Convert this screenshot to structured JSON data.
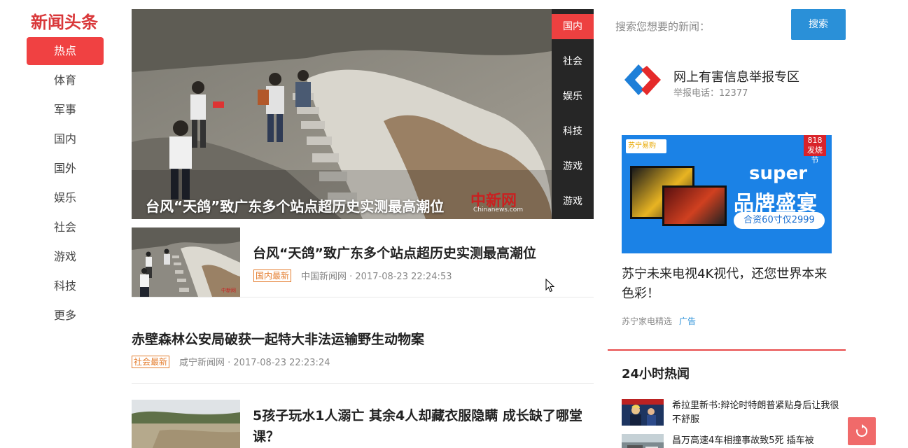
{
  "brand": {
    "logo_text": "新闻头条",
    "accent": "#f04142"
  },
  "nav": {
    "items": [
      {
        "label": "热点",
        "active": true
      },
      {
        "label": "体育"
      },
      {
        "label": "军事"
      },
      {
        "label": "国内"
      },
      {
        "label": "国外"
      },
      {
        "label": "娱乐"
      },
      {
        "label": "社会"
      },
      {
        "label": "游戏"
      },
      {
        "label": "科技"
      },
      {
        "label": "更多"
      }
    ]
  },
  "hero": {
    "title": "台风“天鸽”致广东多个站点超历史实测最高潮位",
    "watermark": "中新网",
    "watermark_sub": "Chinanews.com",
    "tabs": [
      "国内",
      "社会",
      "娱乐",
      "科技",
      "游戏",
      "游戏"
    ]
  },
  "feed": [
    {
      "title": "台风“天鸽”致广东多个站点超历史实测最高潮位",
      "tag": "国内最新",
      "meta": "中国新闻网 · 2017-08-23 22:24:53"
    },
    {
      "title": "赤壁森林公安局破获一起特大非法运输野生动物案",
      "tag": "社会最新",
      "meta": "咸宁新闻网 · 2017-08-23 22:23:24"
    },
    {
      "title": "5孩子玩水1人溺亡 其余4人却藏衣服隐瞒 成长缺了哪堂课？"
    }
  ],
  "search": {
    "label": "搜索您想要的新闻：",
    "button": "搜索"
  },
  "report": {
    "title": "网上有害信息举报专区",
    "phone": "举报电话：12377"
  },
  "ad": {
    "logo": "苏宁易购",
    "badge_top": "818",
    "badge_bottom": "发烧节",
    "super": "super",
    "headline": "品牌盛宴",
    "pill": "合资60寸仅2999",
    "caption": "苏宁未来电视4K视代，还您世界本来色彩！",
    "source": "苏宁家电精选",
    "mark": "广告"
  },
  "hot": {
    "title": "24小时热闻",
    "items": [
      {
        "text": "希拉里新书:辩论时特朗普紧贴身后让我很不舒服"
      },
      {
        "text": "昌万高速4车相撞事故致5死 插车被"
      }
    ]
  }
}
